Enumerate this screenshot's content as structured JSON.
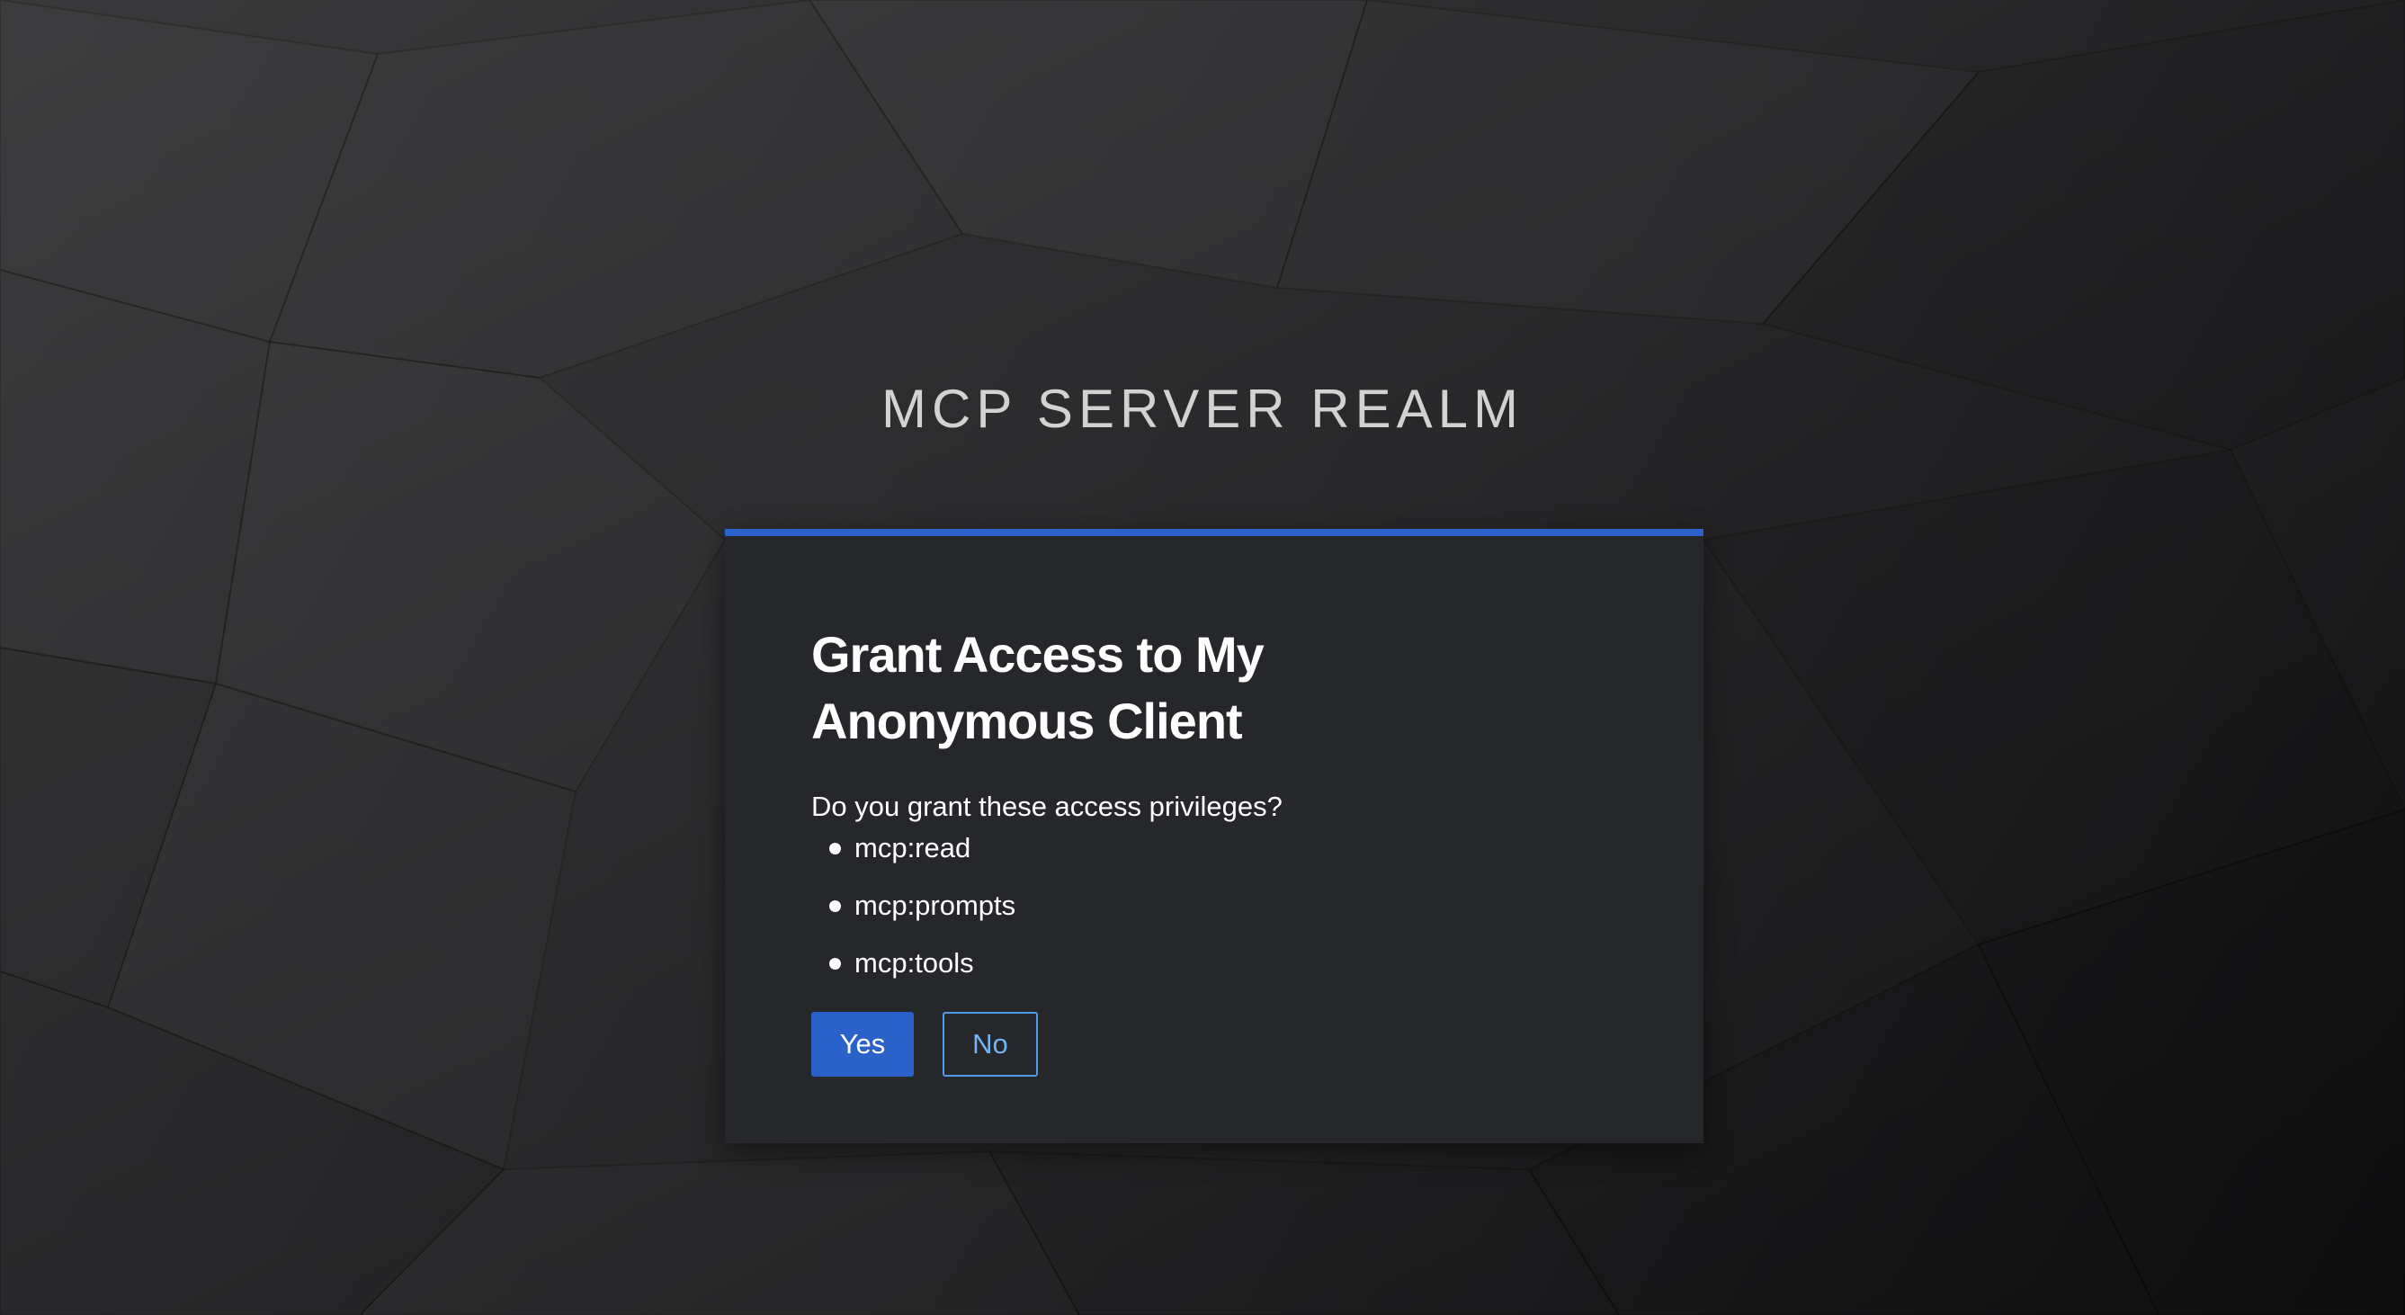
{
  "realm": {
    "title": "MCP SERVER REALM"
  },
  "consent": {
    "heading": "Grant Access to My Anonymous Client",
    "question": "Do you grant these access privileges?",
    "scopes": [
      "mcp:read",
      "mcp:prompts",
      "mcp:tools"
    ],
    "yes_label": "Yes",
    "no_label": "No"
  },
  "colors": {
    "accent": "#2b62c9",
    "card_background": "#26272b",
    "outline_button": "#4f9be8"
  }
}
